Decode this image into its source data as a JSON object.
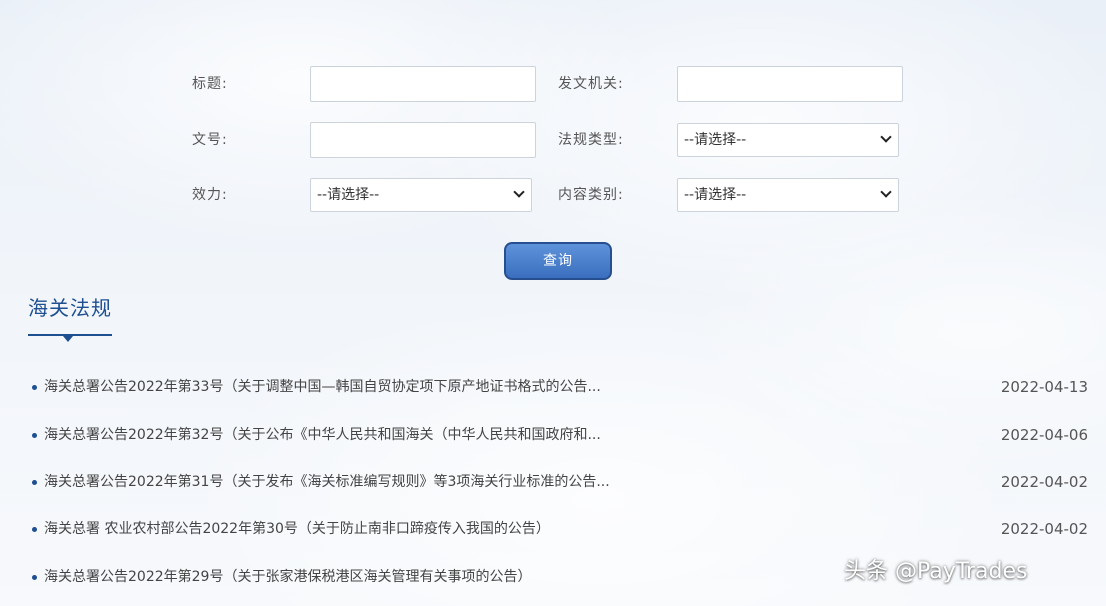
{
  "search_form": {
    "title_label": "标题:",
    "issuer_label": "发文机关:",
    "doc_no_label": "文号:",
    "regulation_type_label": "法规类型:",
    "validity_label": "效力:",
    "content_category_label": "内容类别:",
    "regulation_type_value": "--请选择--",
    "validity_value": "--请选择--",
    "content_category_value": "--请选择--",
    "query_button": "查询"
  },
  "section": {
    "title": "海关法规"
  },
  "news": [
    {
      "title": "海关总署公告2022年第33号（关于调整中国—韩国自贸协定项下原产地证书格式的公告...",
      "date": "2022-04-13"
    },
    {
      "title": "海关总署公告2022年第32号（关于公布《中华人民共和国海关（中华人民共和国政府和...",
      "date": "2022-04-06"
    },
    {
      "title": "海关总署公告2022年第31号（关于发布《海关标准编写规则》等3项海关行业标准的公告...",
      "date": "2022-04-02"
    },
    {
      "title": "海关总署 农业农村部公告2022年第30号（关于防止南非口蹄疫传入我国的公告）",
      "date": "2022-04-02"
    },
    {
      "title": "海关总署公告2022年第29号（关于张家港保税港区海关管理有关事项的公告）",
      "date": ""
    }
  ],
  "watermark": "头条 @PayTrades",
  "colors": {
    "accent": "#1d4f91",
    "button": "#3a6fbf"
  }
}
